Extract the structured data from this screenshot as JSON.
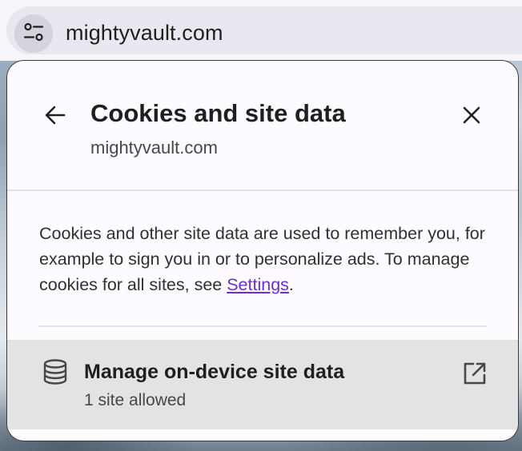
{
  "omnibox": {
    "url": "mightyvault.com",
    "site_info_icon": "tune-icon"
  },
  "popup": {
    "title": "Cookies and site data",
    "subtitle": "mightyvault.com",
    "back_icon": "arrow-left-icon",
    "close_icon": "close-icon",
    "description_text": "Cookies and other site data are used to remember you, for example to sign you in or to personalize ads. To manage cookies for all sites, see ",
    "settings_link": "Settings",
    "description_end": ".",
    "manage_row": {
      "title": "Manage on-device site data",
      "subtitle": "1 site allowed",
      "icon": "database-icon",
      "external_icon": "open-in-new-icon"
    }
  },
  "colors": {
    "accent_link": "#6b2fd1",
    "popup_bg": "#fdfbff",
    "row_hover_bg": "#e3e3e3"
  }
}
